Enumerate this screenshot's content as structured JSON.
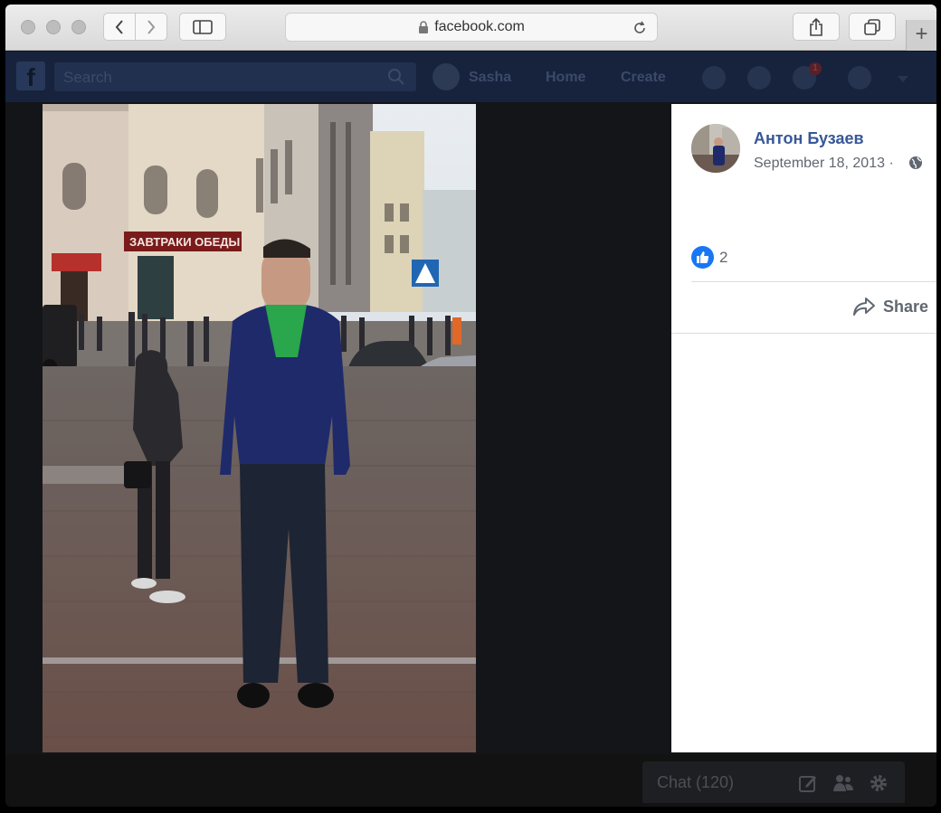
{
  "browser": {
    "url": "facebook.com"
  },
  "fb_header": {
    "search_placeholder": "Search",
    "user_name": "Sasha",
    "home_label": "Home",
    "create_label": "Create",
    "notification_count": "1",
    "logo": "f"
  },
  "post": {
    "author": "Антон Бузаев",
    "date": "September 18, 2013",
    "date_separator": "·",
    "like_count": "2",
    "share_label": "Share"
  },
  "photo": {
    "sign_text": "ЗАВТРАКИ ОБЕДЫ"
  },
  "chat": {
    "label": "Chat (120)"
  },
  "colors": {
    "fb_blue": "#385898",
    "like_blue": "#1877f2",
    "secondary_text": "#606770"
  }
}
